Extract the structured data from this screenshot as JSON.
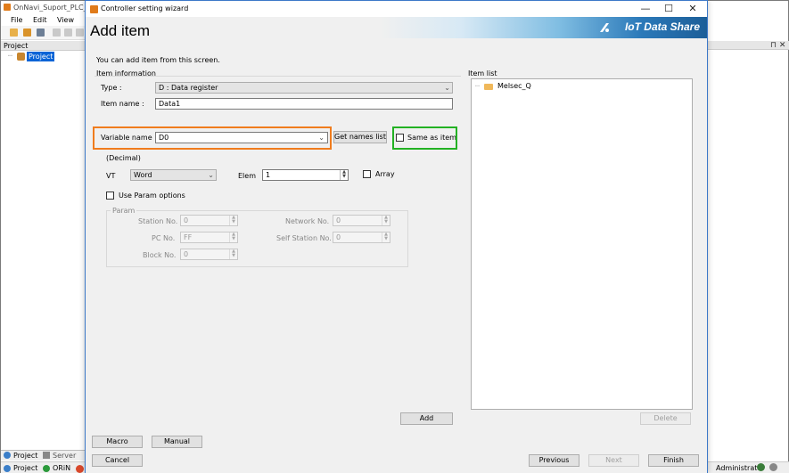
{
  "background_app": {
    "title": "OnNavi_Suport_PLC_h",
    "menu": [
      "File",
      "Edit",
      "View"
    ],
    "project_panel_title": "Project",
    "tree_root": "Project",
    "bottom_tabs": [
      "Project",
      "Server"
    ],
    "status_items": [
      "Project",
      "ORiN"
    ],
    "user": "Administrator"
  },
  "dialog": {
    "title": "Controller setting wizard",
    "heading": "Add item",
    "banner_text": "IoT Data Share",
    "intro": "You can add item from this screen.",
    "item_information": {
      "section_label": "Item information",
      "type_label": "Type :",
      "type_value": "D : Data register",
      "item_name_label": "Item name :",
      "item_name_value": "Data1",
      "variable_name_label": "Variable name :",
      "variable_name_value": "D0",
      "get_names_button": "Get names list",
      "same_as_item_label": "Same as item",
      "decimal_label": "(Decimal)",
      "vt_label": "VT",
      "vt_value": "Word",
      "elem_label": "Elem",
      "elem_value": "1",
      "array_label": "Array",
      "use_param_label": "Use Param options"
    },
    "param": {
      "group_label": "Param",
      "station_no_label": "Station No.",
      "station_no_value": "0",
      "network_no_label": "Network No.",
      "network_no_value": "0",
      "pc_no_label": "PC No.",
      "pc_no_value": "FF",
      "self_station_no_label": "Self Station No.",
      "self_station_no_value": "0",
      "block_no_label": "Block No.",
      "block_no_value": "0"
    },
    "item_list": {
      "label": "Item list",
      "tree_node": "Melsec_Q"
    },
    "buttons": {
      "add": "Add",
      "delete": "Delete",
      "macro": "Macro",
      "manual": "Manual",
      "cancel": "Cancel",
      "previous": "Previous",
      "next": "Next",
      "finish": "Finish"
    }
  },
  "colors": {
    "highlight_variable_name": "#f07c1d",
    "highlight_same_as_item": "#23b123",
    "selection_blue": "#0a64d6",
    "banner_blue": "#1c5e98"
  }
}
